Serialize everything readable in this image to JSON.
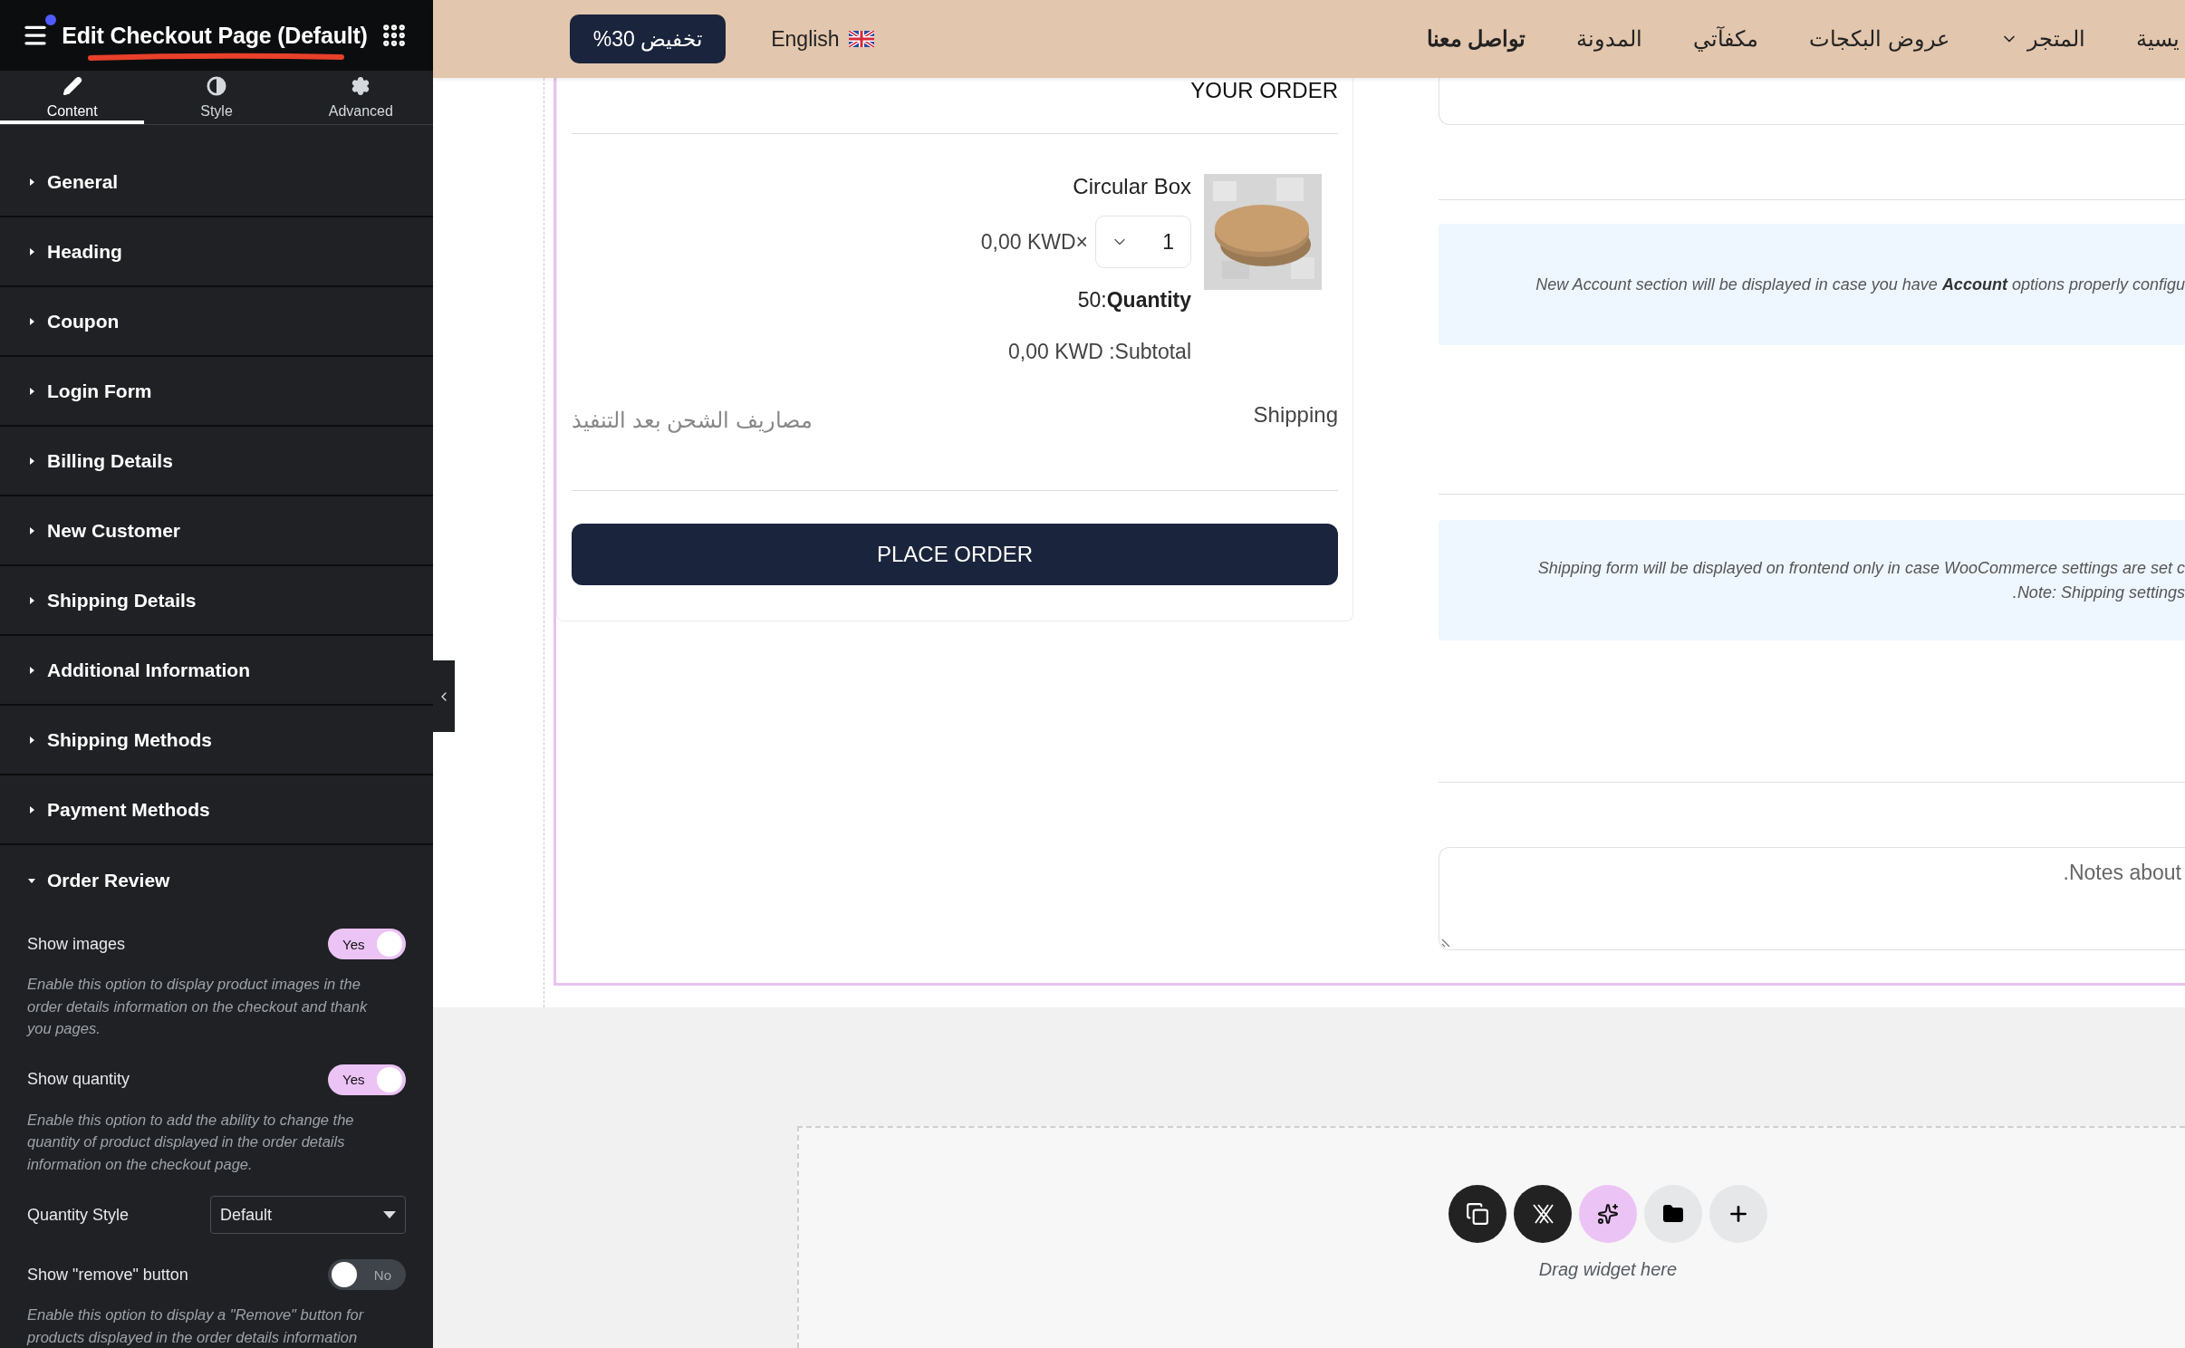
{
  "editor": {
    "title": "Edit Checkout Page (Default)",
    "tabs": [
      {
        "label": "Content",
        "selected": true
      },
      {
        "label": "Style",
        "selected": false
      },
      {
        "label": "Advanced",
        "selected": false
      }
    ],
    "sections": [
      {
        "label": "General",
        "expanded": false
      },
      {
        "label": "Heading",
        "expanded": false
      },
      {
        "label": "Coupon",
        "expanded": false
      },
      {
        "label": "Login Form",
        "expanded": false
      },
      {
        "label": "Billing Details",
        "expanded": false
      },
      {
        "label": "New Customer",
        "expanded": false
      },
      {
        "label": "Shipping Details",
        "expanded": false
      },
      {
        "label": "Additional Information",
        "expanded": false
      },
      {
        "label": "Shipping Methods",
        "expanded": false
      },
      {
        "label": "Payment Methods",
        "expanded": false
      },
      {
        "label": "Order Review",
        "expanded": true
      }
    ],
    "controls": [
      {
        "kind": "toggle",
        "label": "Show images",
        "on": true,
        "state_label": "Yes",
        "description": "Enable this option to display product images in the order details information on the checkout and thank you pages."
      },
      {
        "kind": "toggle",
        "label": "Show quantity",
        "on": true,
        "state_label": "Yes",
        "description": "Enable this option to add the ability to change the quantity of product displayed in the order details information on the checkout page."
      },
      {
        "kind": "select",
        "label": "Quantity Style",
        "value": "Default"
      },
      {
        "kind": "toggle",
        "label": "Show \"remove\" button",
        "on": false,
        "state_label": "No",
        "description": "Enable this option to display a \"Remove\" button for products displayed in the order details information"
      }
    ]
  },
  "site_nav": {
    "items": [
      {
        "label": "يسية",
        "dropdown": false,
        "bold": false
      },
      {
        "label": "المتجر",
        "dropdown": true,
        "bold": false
      },
      {
        "label": "عروض البكجات",
        "dropdown": false,
        "bold": false
      },
      {
        "label": "مكفآتي",
        "dropdown": false,
        "bold": false
      },
      {
        "label": "المدونة",
        "dropdown": false,
        "bold": false
      },
      {
        "label": "تواصل معنا",
        "dropdown": false,
        "bold": true
      }
    ],
    "language": "English",
    "promo_button": "%30 تخفيض"
  },
  "order": {
    "heading": "YOUR ORDER",
    "item": {
      "name": "Circular Box",
      "price": "0,00 KWD×",
      "quantity_input": "1",
      "quantity_line": "50:**Quantity**",
      "subtotal": "0,00 KWD :Subtotal"
    },
    "shipping": {
      "label": "Shipping",
      "value": "مصاريف الشحن بعد التنفيذ"
    },
    "place_order": "PLACE ORDER"
  },
  "checkout_form": {
    "notices": [
      {
        "lines": [
          "New Account section will be displayed in case you have **Account** options properly configu"
        ]
      },
      {
        "lines": [
          "Shipping form will be displayed on frontend only in case WooCommerce settings are set c",
          "Note: Shipping settings."
        ]
      }
    ],
    "notes_placeholder": "Notes about."
  },
  "drop_zone": {
    "hint": "Drag widget here"
  }
}
